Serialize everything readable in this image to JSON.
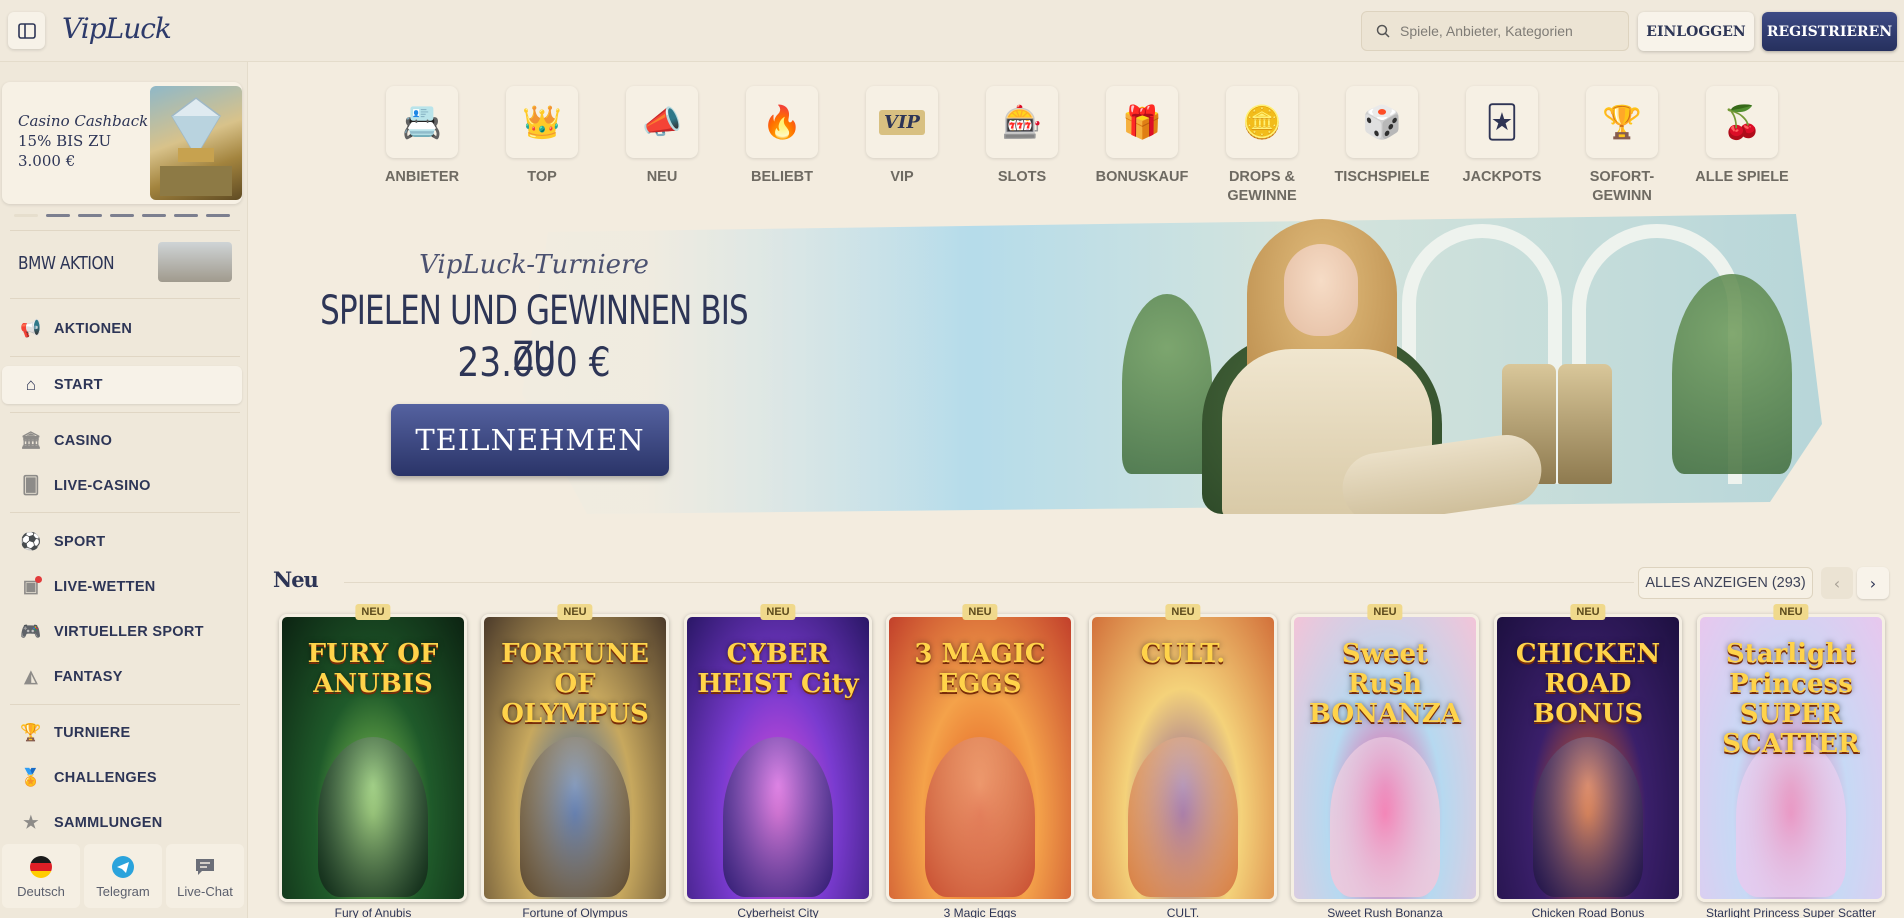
{
  "brand": {
    "name": "VipLuck"
  },
  "header": {
    "search_placeholder": "Spiele, Anbieter, Kategorien",
    "login_label": "EINLOGGEN",
    "register_label": "REGISTRIEREN"
  },
  "sidebar": {
    "promo": {
      "title": "Casino Cashback",
      "line1": "15% BIS ZU",
      "line2": "3.000 €"
    },
    "bmw_label": "BMW AKTION",
    "items": [
      {
        "label": "AKTIONEN",
        "icon": "megaphone-icon"
      },
      {
        "label": "START",
        "icon": "home-icon"
      },
      {
        "label": "CASINO",
        "icon": "casino-icon"
      },
      {
        "label": "LIVE-CASINO",
        "icon": "cards-icon"
      },
      {
        "label": "SPORT",
        "icon": "soccer-ball-icon"
      },
      {
        "label": "LIVE-WETTEN",
        "icon": "live-tv-icon"
      },
      {
        "label": "VIRTUELLER SPORT",
        "icon": "gamepad-icon"
      },
      {
        "label": "FANTASY",
        "icon": "fantasy-icon"
      },
      {
        "label": "TURNIERE",
        "icon": "trophy-icon"
      },
      {
        "label": "CHALLENGES",
        "icon": "medal-icon"
      },
      {
        "label": "SAMMLUNGEN",
        "icon": "collection-icon"
      }
    ],
    "bottom": [
      {
        "label": "Deutsch",
        "icon": "german-flag-icon"
      },
      {
        "label": "Telegram",
        "icon": "telegram-icon"
      },
      {
        "label": "Live-Chat",
        "icon": "chat-icon"
      }
    ]
  },
  "categories": [
    {
      "label": "ANBIETER",
      "icon": "provider-icon"
    },
    {
      "label": "TOP",
      "icon": "crown-icon"
    },
    {
      "label": "NEU",
      "icon": "megaphone-icon"
    },
    {
      "label": "BELIEBT",
      "icon": "flame-icon"
    },
    {
      "label": "VIP",
      "icon": "vip-icon"
    },
    {
      "label": "SLOTS",
      "icon": "slot-machine-icon"
    },
    {
      "label": "BONUSKAUF",
      "icon": "gift-icon"
    },
    {
      "label": "DROPS &\nGEWINNE",
      "icon": "coin-icon"
    },
    {
      "label": "TISCHSPIELE",
      "icon": "dice-icon"
    },
    {
      "label": "JACKPOTS",
      "icon": "playing-cards-icon"
    },
    {
      "label": "SOFORT-\nGEWINN",
      "icon": "trophy-icon"
    },
    {
      "label": "ALLE SPIELE",
      "icon": "cherries-icon"
    }
  ],
  "banner": {
    "subtitle": "VipLuck-Turniere",
    "title": "SPIELEN UND GEWINNEN BIS ZU",
    "amount": "23.000 €",
    "button_label": "TEILNEHMEN"
  },
  "new_section": {
    "title": "Neu",
    "show_all_label": "ALLES ANZEIGEN (293)",
    "badge_label": "NEU",
    "games": [
      {
        "name": "Fury of Anubis",
        "logo": "FURY OF ANUBIS",
        "colors": [
          "#1f5a2a",
          "#0c2312",
          "#8fd35a"
        ]
      },
      {
        "name": "Fortune of Olympus",
        "logo": "FORTUNE OF OLYMPUS",
        "colors": [
          "#c7a85e",
          "#4b3a2a",
          "#2a5bb0"
        ]
      },
      {
        "name": "Cyberheist City",
        "logo": "CYBER HEIST City",
        "colors": [
          "#7a3bd0",
          "#2a1766",
          "#e64fd9"
        ]
      },
      {
        "name": "3 Magic Eggs",
        "logo": "3 MAGIC EGGS",
        "colors": [
          "#f4a24a",
          "#c2402b",
          "#e0571f"
        ]
      },
      {
        "name": "CULT.",
        "logo": "CULT.",
        "colors": [
          "#f4d27a",
          "#d2703a",
          "#7a4aa0"
        ]
      },
      {
        "name": "Sweet Rush Bonanza",
        "logo": "Sweet Rush BONANZA",
        "colors": [
          "#b6d9f0",
          "#f3c4d8",
          "#ee3f8f"
        ]
      },
      {
        "name": "Chicken Road Bonus",
        "logo": "CHICKEN ROAD BONUS",
        "colors": [
          "#3a1f6a",
          "#1d1040",
          "#f26a1b"
        ]
      },
      {
        "name": "Starlight Princess Super Scatter",
        "logo": "Starlight Princess SUPER SCATTER",
        "colors": [
          "#c7d9f5",
          "#e8c7ee",
          "#e05fa0"
        ]
      }
    ]
  }
}
